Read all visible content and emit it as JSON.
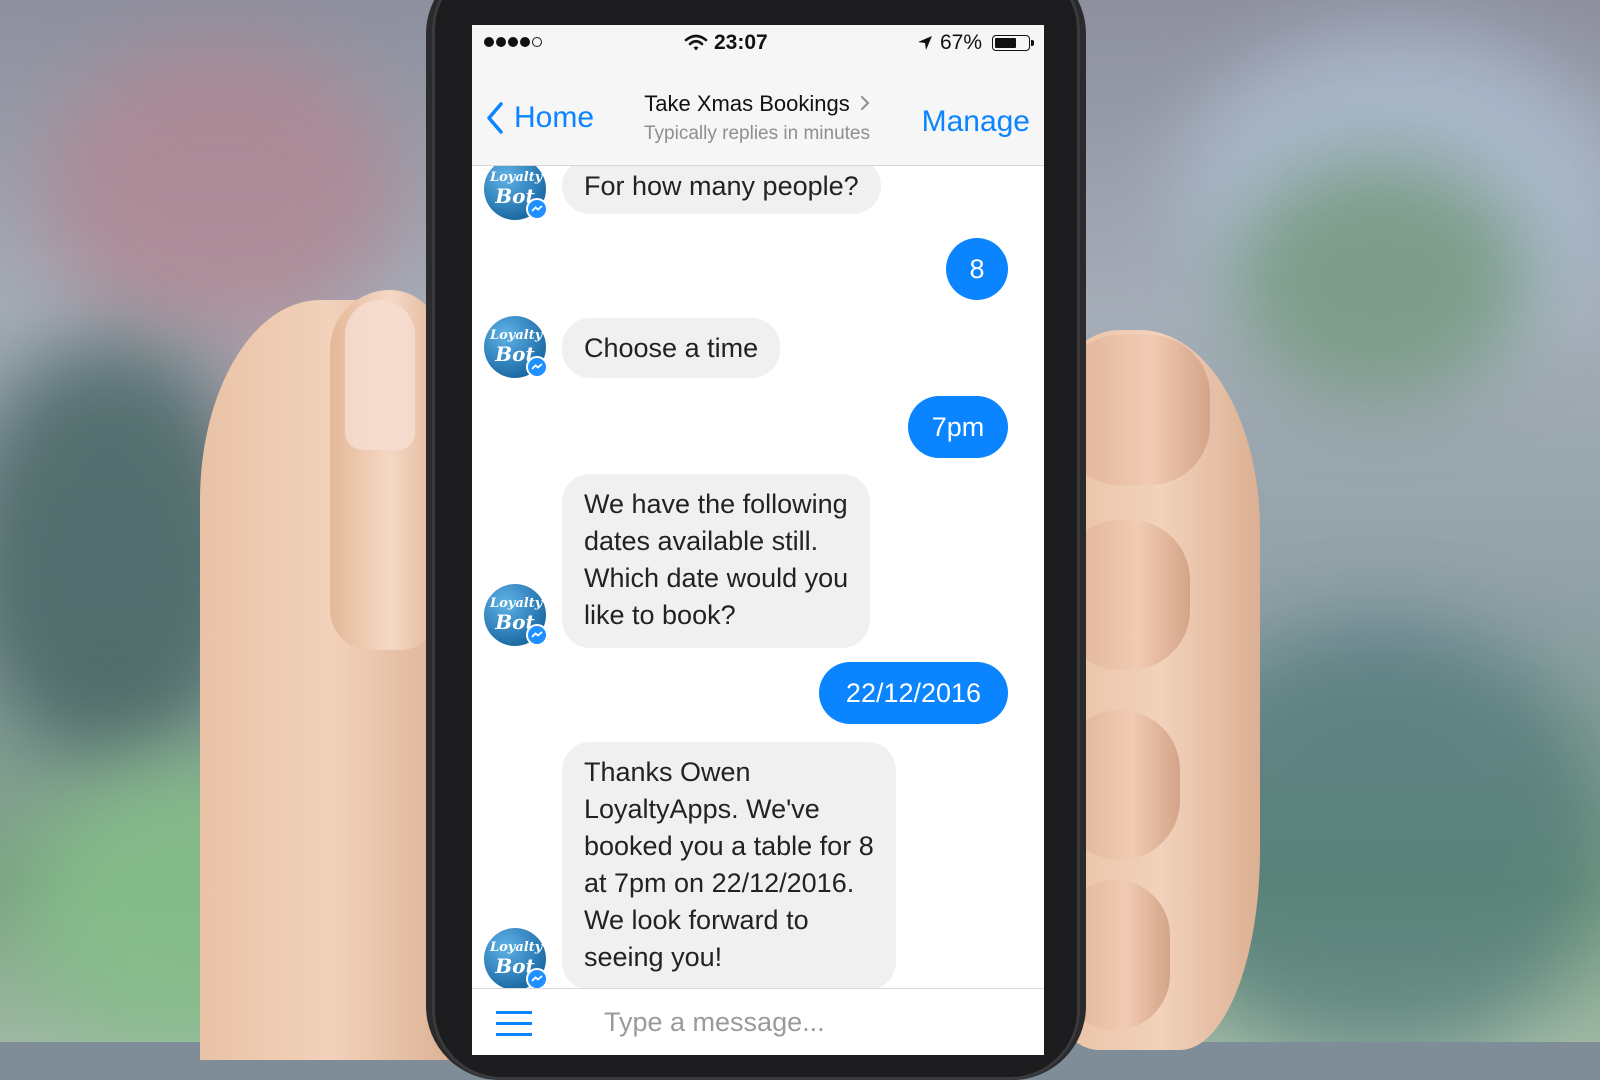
{
  "status_bar": {
    "time": "23:07",
    "battery_percent": "67%",
    "battery_level": 0.67,
    "signal_bars": 4,
    "icons": [
      "signal-dots-icon",
      "wifi-icon",
      "location-arrow-icon",
      "battery-icon"
    ]
  },
  "nav": {
    "back_label": "Home",
    "title": "Take Xmas Bookings",
    "subtitle": "Typically replies in minutes",
    "manage_label": "Manage"
  },
  "avatar": {
    "line1": "Loyalty",
    "line2": "Bot"
  },
  "messages": [
    {
      "from": "bot",
      "text": "For how many people?"
    },
    {
      "from": "user",
      "text": "8"
    },
    {
      "from": "bot",
      "text": "Choose a time"
    },
    {
      "from": "user",
      "text": "7pm"
    },
    {
      "from": "bot",
      "lines": [
        "We have the following",
        "dates available still.",
        "Which date would you",
        "like to book?"
      ]
    },
    {
      "from": "user",
      "text": "22/12/2016"
    },
    {
      "from": "bot",
      "lines": [
        "Thanks Owen",
        "LoyaltyApps. We've",
        "booked you a table for 8",
        "at 7pm on 22/12/2016.",
        "We look forward to",
        "seeing you!"
      ]
    }
  ],
  "composer": {
    "placeholder": "Type a message..."
  },
  "colors": {
    "accent": "#0a84ff",
    "bot_bubble": "#f0f0f0",
    "bar_bg": "#f6f6f7"
  }
}
